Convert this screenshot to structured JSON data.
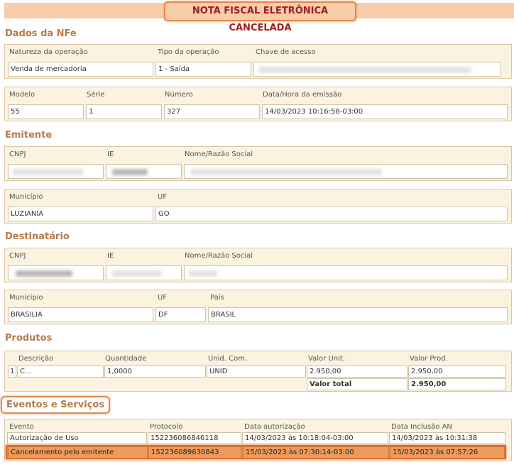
{
  "banner": {
    "title": "NOTA FISCAL ELETRÔNICA CANCELADA"
  },
  "sections": {
    "dados": "Dados da NFe",
    "emitente": "Emitente",
    "destinatario": "Destinatário",
    "produtos": "Produtos",
    "eventos": "Eventos e Serviços"
  },
  "nfe": {
    "natureza_label": "Natureza da operação",
    "natureza_value": "Venda de mercadoria",
    "tipo_label": "Tipo da operação",
    "tipo_value": "1 - Saída",
    "chave_label": "Chave de acesso",
    "modelo_label": "Modelo",
    "modelo_value": "55",
    "serie_label": "Série",
    "serie_value": "1",
    "numero_label": "Número",
    "numero_value": "327",
    "data_label": "Data/Hora da emissão",
    "data_value": "14/03/2023 10:16:58-03:00"
  },
  "emitente": {
    "cnpj_label": "CNPJ",
    "ie_label": "IE",
    "nome_label": "Nome/Razão Social",
    "municipio_label": "Município",
    "municipio_value": "LUZIANIA",
    "uf_label": "UF",
    "uf_value": "GO"
  },
  "destinatario": {
    "cnpj_label": "CNPJ",
    "ie_label": "IE",
    "nome_label": "Nome/Razão Social",
    "municipio_label": "Município",
    "municipio_value": "BRASILIA",
    "uf_label": "UF",
    "uf_value": "DF",
    "pais_label": "País",
    "pais_value": "BRASIL"
  },
  "produtos": {
    "headers": [
      "Descrição",
      "Quantidade",
      "Unid. Com.",
      "Valor Unit.",
      "Valor Prod."
    ],
    "row": {
      "num": "1",
      "descricao": "C...",
      "quantidade": "1,0000",
      "unid": "UNID",
      "valor_unit": "2.950,00",
      "valor_prod": "2.950,00"
    },
    "total_label": "Valor total",
    "total_value": "2.950,00"
  },
  "eventos": {
    "headers": [
      "Evento",
      "Protocolo",
      "Data autorização",
      "Data Inclusão AN"
    ],
    "rows": [
      {
        "evento": "Autorização de Uso",
        "protocolo": "152236086846118",
        "data_aut": "14/03/2023 às 10:18:04-03:00",
        "data_an": "14/03/2023 às 10:31:38"
      },
      {
        "evento": "Cancelamento pelo emitente",
        "protocolo": "152236089630843",
        "data_aut": "15/03/2023 às 07:30:14-03:00",
        "data_an": "15/03/2023 às 07:57:26"
      }
    ]
  }
}
